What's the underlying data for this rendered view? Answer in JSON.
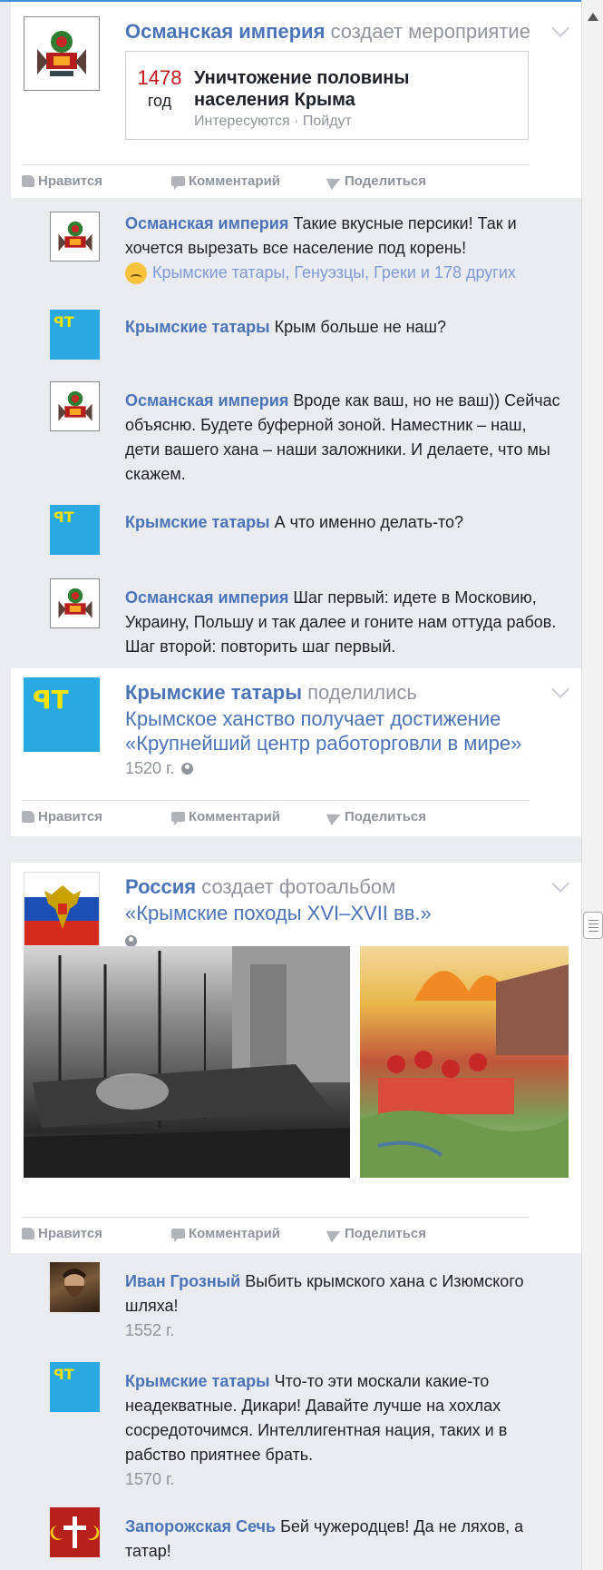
{
  "post_event": {
    "author": "Османская империя",
    "verb": "создает мероприятие",
    "event": {
      "year": "1478",
      "year_label": "год",
      "title": "Уничтожение половины населения Крыма",
      "subtitle": "Интересуются · Пойдут"
    }
  },
  "actions": {
    "like": "Нравится",
    "comment": "Комментарий",
    "share": "Поделиться"
  },
  "comments_1": [
    {
      "author": "Османская империя",
      "text": "Такие вкусные персики! Так и хочется вырезать все население под корень!",
      "reactions": "Крымские татары, Генуэзцы, Греки и 178 других"
    },
    {
      "author": "Крымские татары",
      "text": "Крым больше не наш?"
    },
    {
      "author": "Османская империя",
      "text": "Вроде как ваш, но не ваш)) Сейчас объясню. Будете буферной зоной. Наместник – наш, дети вашего хана – наши заложники. И делаете, что мы скажем."
    },
    {
      "author": "Крымские татары",
      "text": "А что именно делать-то?"
    },
    {
      "author": "Османская империя",
      "text": "Шаг первый: идете в Московию, Украину, Польшу и так далее и гоните нам оттуда рабов. Шаг второй: повторить шаг первый."
    }
  ],
  "post_share": {
    "author": "Крымские татары",
    "verb": "поделились",
    "title": "Крымское ханство получает достижение «Крупнейший центр работорговли в мире»",
    "date": "1520 г."
  },
  "post_album": {
    "author": "Россия",
    "verb": "создает фотоальбом",
    "title": "«Крымские походы XVI–XVII вв.»"
  },
  "comments_2": [
    {
      "author": "Иван Грозный",
      "text": "Выбить крымского хана с Изюмского шляха!",
      "date": "1552 г."
    },
    {
      "author": "Крымские татары",
      "text": "Что-то эти москали какие-то неадекватные. Дикари! Давайте лучше на хохлах сосредоточимся. Интеллигентная нация, таких и в рабство приятнее брать.",
      "date": "1570 г."
    },
    {
      "author": "Запорожская Сечь",
      "text": "Бей чужеродцев! Да не ляхов, а татар!"
    }
  ],
  "icons": [
    "thumbs-up-icon",
    "comment-icon",
    "share-icon",
    "chevron-down-icon",
    "globe-icon",
    "sad-emoji-icon",
    "scroll-up-icon"
  ],
  "colors": {
    "name": "#4a73b8",
    "muted": "#90949c",
    "accent_top": "#3b8fd8",
    "event_year": "#c4161c",
    "tatar_flag": "#29a8e2",
    "tamga": "#f5e400"
  }
}
